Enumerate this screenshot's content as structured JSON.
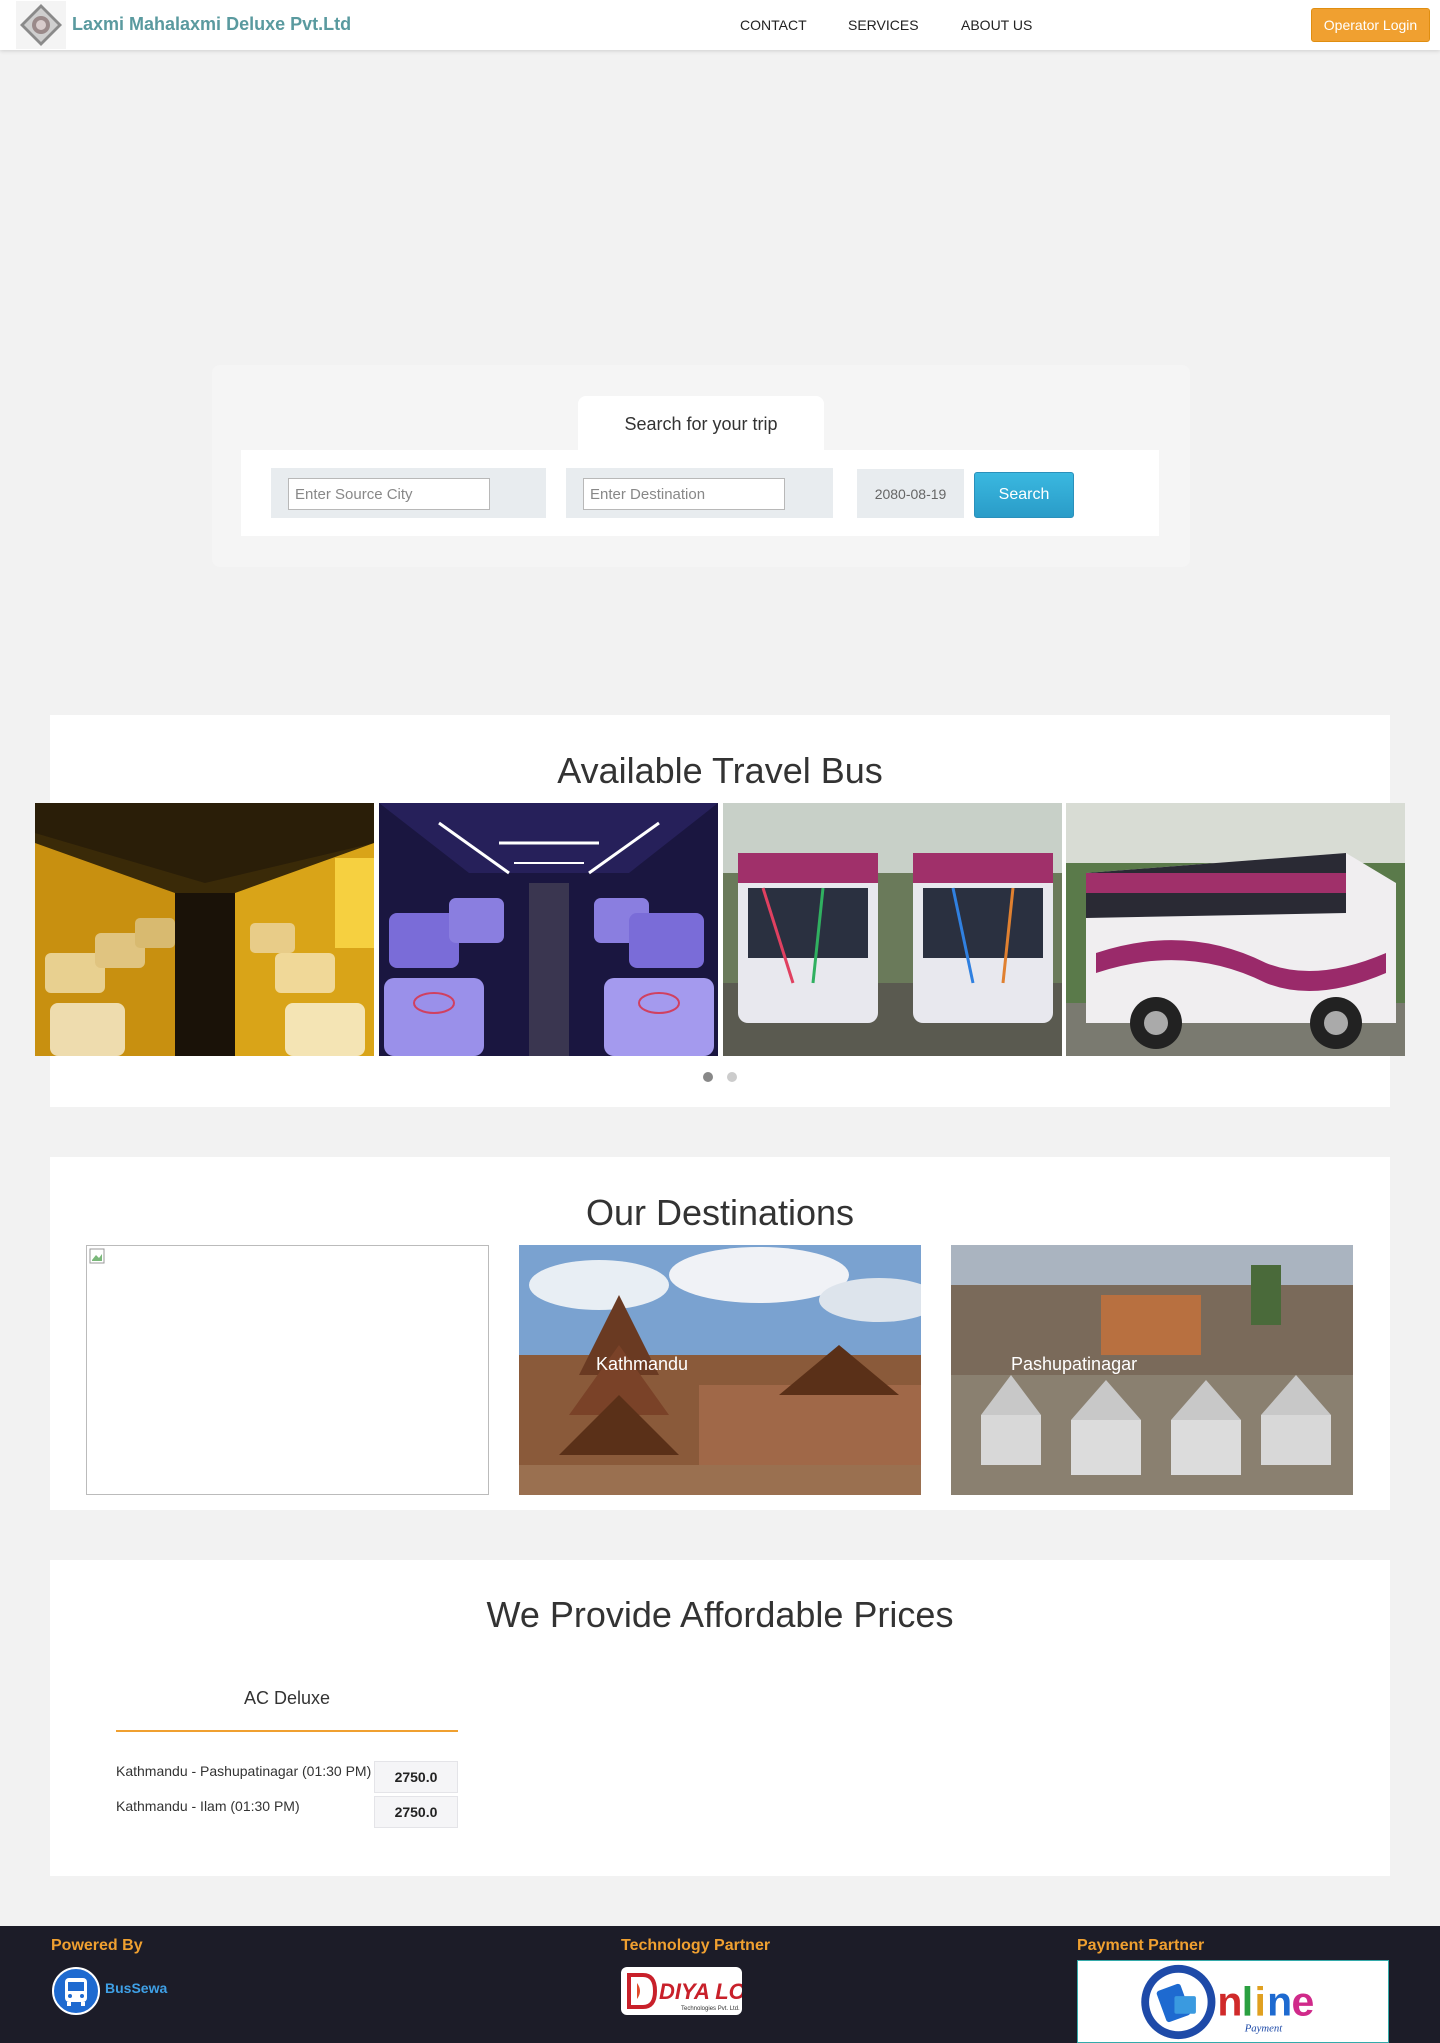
{
  "header": {
    "brand": "Laxmi Mahalaxmi Deluxe Pvt.Ltd",
    "nav": [
      "CONTACT",
      "SERVICES",
      "ABOUT US"
    ],
    "operator_login": "Operator Login",
    "logo_icon": "company-emblem-logo"
  },
  "search": {
    "tab_label": "Search for your trip",
    "source_placeholder": "Enter Source City",
    "destination_placeholder": "Enter Destination",
    "date_value": "2080-08-19",
    "button_label": "Search",
    "button_color": "#2a9cc8"
  },
  "travel_bus": {
    "title": "Available Travel Bus",
    "images": [
      "bus-interior-yellow-seats",
      "bus-interior-blue-seats",
      "two-buses-front-view",
      "bus-side-view"
    ],
    "carousel_pages": 2,
    "active_page": 1
  },
  "destinations": {
    "title": "Our Destinations",
    "items": [
      {
        "label": "",
        "image": "broken-image"
      },
      {
        "label": "Kathmandu",
        "image": "kathmandu-temples"
      },
      {
        "label": "Pashupatinagar",
        "image": "pashupatinath-temples"
      }
    ]
  },
  "prices": {
    "title": "We Provide Affordable Prices",
    "category": "AC Deluxe",
    "routes": [
      {
        "route": "Kathmandu - Pashupatinagar (01:30 PM)",
        "price": "2750.0"
      },
      {
        "route": "Kathmandu - Ilam (01:30 PM)",
        "price": "2750.0"
      }
    ]
  },
  "footer": {
    "powered_by": "Powered By",
    "powered_name": "BusSewa",
    "tech_partner": "Technology Partner",
    "tech_logo": "diyalo-technologies-logo",
    "payment_partner": "Payment Partner",
    "payment_logo": "online-payment-logo",
    "accent_color": "#f0a030"
  }
}
